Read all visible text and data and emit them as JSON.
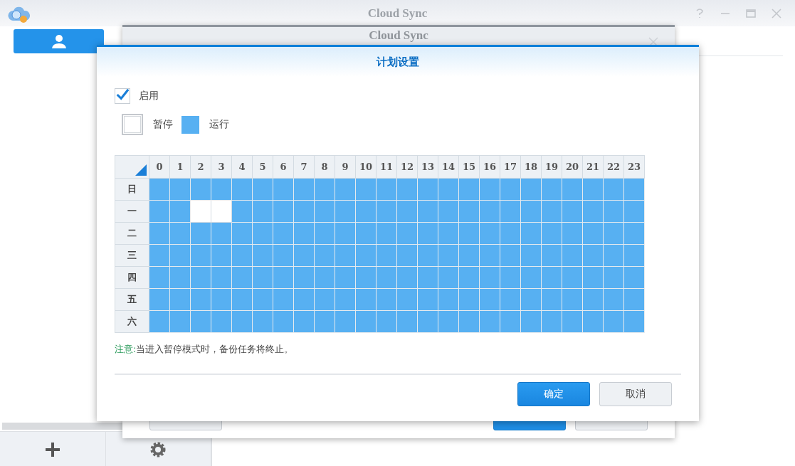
{
  "window": {
    "title": "Cloud Sync"
  },
  "sidebar": {
    "items": [
      {
        "kind": "user",
        "selected": true
      }
    ]
  },
  "background_dialog": {
    "title": "Cloud Sync"
  },
  "dialog": {
    "title": "计划设置",
    "enable": {
      "label": "启用",
      "checked": true
    },
    "legend": [
      {
        "kind": "pause",
        "label": "暂停"
      },
      {
        "kind": "run",
        "label": "运行"
      }
    ],
    "hours": [
      "0",
      "1",
      "2",
      "3",
      "4",
      "5",
      "6",
      "7",
      "8",
      "9",
      "10",
      "11",
      "12",
      "13",
      "14",
      "15",
      "16",
      "17",
      "18",
      "19",
      "20",
      "21",
      "22",
      "23"
    ],
    "rows": [
      {
        "day": "日",
        "slots": [
          true,
          true,
          true,
          true,
          true,
          true,
          true,
          true,
          true,
          true,
          true,
          true,
          true,
          true,
          true,
          true,
          true,
          true,
          true,
          true,
          true,
          true,
          true,
          true
        ]
      },
      {
        "day": "一",
        "slots": [
          true,
          true,
          false,
          false,
          true,
          true,
          true,
          true,
          true,
          true,
          true,
          true,
          true,
          true,
          true,
          true,
          true,
          true,
          true,
          true,
          true,
          true,
          true,
          true
        ]
      },
      {
        "day": "二",
        "slots": [
          true,
          true,
          true,
          true,
          true,
          true,
          true,
          true,
          true,
          true,
          true,
          true,
          true,
          true,
          true,
          true,
          true,
          true,
          true,
          true,
          true,
          true,
          true,
          true
        ]
      },
      {
        "day": "三",
        "slots": [
          true,
          true,
          true,
          true,
          true,
          true,
          true,
          true,
          true,
          true,
          true,
          true,
          true,
          true,
          true,
          true,
          true,
          true,
          true,
          true,
          true,
          true,
          true,
          true
        ]
      },
      {
        "day": "四",
        "slots": [
          true,
          true,
          true,
          true,
          true,
          true,
          true,
          true,
          true,
          true,
          true,
          true,
          true,
          true,
          true,
          true,
          true,
          true,
          true,
          true,
          true,
          true,
          true,
          true
        ]
      },
      {
        "day": "五",
        "slots": [
          true,
          true,
          true,
          true,
          true,
          true,
          true,
          true,
          true,
          true,
          true,
          true,
          true,
          true,
          true,
          true,
          true,
          true,
          true,
          true,
          true,
          true,
          true,
          true
        ]
      },
      {
        "day": "六",
        "slots": [
          true,
          true,
          true,
          true,
          true,
          true,
          true,
          true,
          true,
          true,
          true,
          true,
          true,
          true,
          true,
          true,
          true,
          true,
          true,
          true,
          true,
          true,
          true,
          true
        ]
      }
    ],
    "note": {
      "label": "注意:",
      "text": "当进入暂停模式时，备份任务将终止。"
    },
    "buttons": [
      {
        "kind": "primary",
        "label": "确定"
      },
      {
        "kind": "secondary",
        "label": "取消"
      }
    ]
  }
}
